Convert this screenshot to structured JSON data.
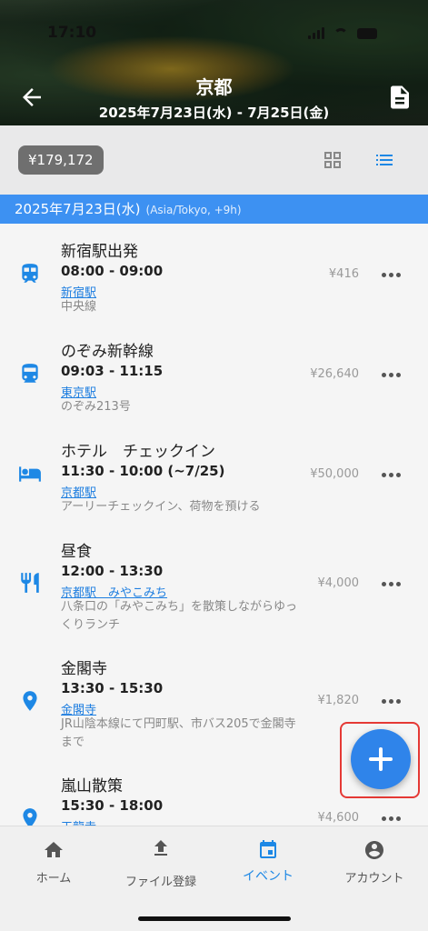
{
  "status": {
    "time": "17:10"
  },
  "header": {
    "title": "京都",
    "dates": "2025年7月23日(水) - 7月25日(金)"
  },
  "summary": {
    "total": "¥179,172"
  },
  "day": {
    "date": "2025年7月23日(水)",
    "tz": "(Asia/Tokyo, +9h)"
  },
  "events": [
    {
      "icon": "train-icon",
      "title": "新宿駅出発",
      "time": "08:00 - 09:00",
      "link": "新宿駅",
      "note": "中央線",
      "price": "¥416"
    },
    {
      "icon": "train-front-icon",
      "title": "のぞみ新幹線",
      "time": "09:03 - 11:15",
      "link": "東京駅",
      "note": "のぞみ213号",
      "price": "¥26,640"
    },
    {
      "icon": "hotel-bed-icon",
      "title": "ホテル　チェックイン",
      "time": "11:30 - 10:00 (~7/25)",
      "link": "京都駅",
      "note": "アーリーチェックイン、荷物を預ける",
      "price": "¥50,000"
    },
    {
      "icon": "restaurant-icon",
      "title": "昼食",
      "time": "12:00 - 13:30",
      "link": "京都駅　みやこみち",
      "note": "八条口の「みやこみち」を散策しながらゆっくりランチ",
      "price": "¥4,000"
    },
    {
      "icon": "location-pin-icon",
      "title": "金閣寺",
      "time": "13:30 - 15:30",
      "link": "金閣寺",
      "note": "JR山陰本線にて円町駅、市バス205で金閣寺まで",
      "price": "¥1,820"
    },
    {
      "icon": "location-pin-icon",
      "title": "嵐山散策",
      "time": "15:30 - 18:00",
      "link": "天龍寺",
      "note": "",
      "price": "¥4,600"
    }
  ],
  "nav": [
    {
      "label": "ホーム",
      "icon": "home-icon"
    },
    {
      "label": "ファイル登録",
      "icon": "upload-icon"
    },
    {
      "label": "イベント",
      "icon": "calendar-icon"
    },
    {
      "label": "アカウント",
      "icon": "account-icon"
    }
  ],
  "colors": {
    "accent": "#3d91f2",
    "link": "#1e7ee0",
    "highlight": "#e53935"
  }
}
